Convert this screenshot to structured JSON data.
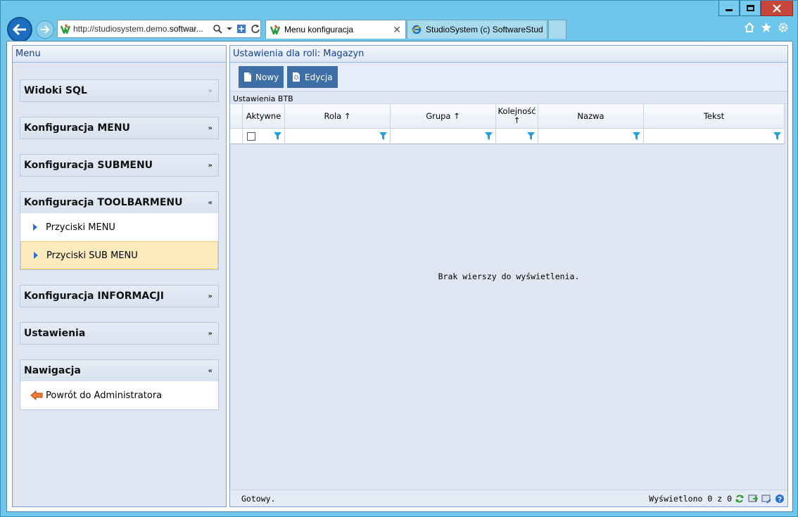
{
  "browser": {
    "url_prefix": "http://studiosystem.demo.",
    "url_domain": "softwar...",
    "tabs": [
      {
        "label": "Menu konfiguracja",
        "close": "✕"
      },
      {
        "label": "StudioSystem (c) SoftwareStud..."
      }
    ]
  },
  "left_panel": {
    "title": "Menu",
    "groups": [
      {
        "label": "Widoki SQL"
      },
      {
        "label": "Konfiguracja MENU"
      },
      {
        "label": "Konfiguracja SUBMENU"
      },
      {
        "label": "Konfiguracja TOOLBARMENU",
        "items": [
          "Przyciski MENU",
          "Przyciski SUB MENU"
        ]
      },
      {
        "label": "Konfiguracja INFORMACJI"
      },
      {
        "label": "Ustawienia"
      },
      {
        "label": "Nawigacja",
        "items": [
          "Powrót do Administratora"
        ]
      }
    ],
    "expand_glyph": "»",
    "collapse_glyph": "«"
  },
  "right_panel": {
    "title": "Ustawienia dla roli: Magazyn",
    "toolbar": {
      "new_label": "Nowy",
      "edit_label": "Edycja"
    },
    "grid_title": "Ustawienia BTB",
    "columns": [
      "Aktywne",
      "Rola ↑",
      "Grupa ↑",
      "Kolejność ↑",
      "Nazwa",
      "Tekst"
    ],
    "empty_message": "Brak wierszy do wyświetlenia.",
    "status_left": "Gotowy.",
    "status_right": "Wyświetlono 0 z 0"
  },
  "colors": {
    "accent": "#3f6fa7",
    "header_text": "#15428b",
    "selected_bg": "#fdebbd"
  }
}
